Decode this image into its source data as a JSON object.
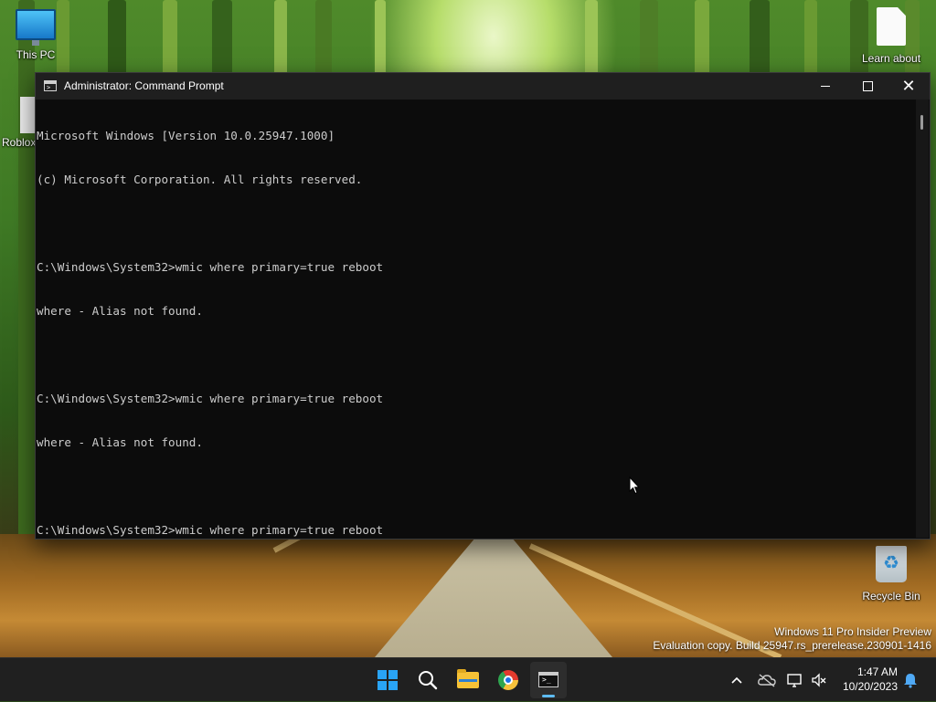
{
  "desktop": {
    "icons": [
      {
        "label": "This PC",
        "icon": "monitor-icon"
      },
      {
        "label": "Learn about",
        "icon": "document-icon"
      },
      {
        "label": "Roblox",
        "icon": "shortcut-icon"
      },
      {
        "label": "Recycle Bin",
        "icon": "recycle-bin-icon"
      }
    ]
  },
  "window": {
    "title": "Administrator: Command Prompt",
    "icon": "cmd-icon",
    "controls": {
      "minimize": "minimize-icon",
      "maximize": "maximize-icon",
      "close": "close-icon"
    }
  },
  "console": {
    "lines": [
      "Microsoft Windows [Version 10.0.25947.1000]",
      "(c) Microsoft Corporation. All rights reserved.",
      "",
      "C:\\Windows\\System32>wmic where primary=true reboot",
      "where - Alias not found.",
      "",
      "C:\\Windows\\System32>wmic where primary=true reboot",
      "where - Alias not found.",
      "",
      "C:\\Windows\\System32>wmic where primary=true reboot"
    ]
  },
  "watermark": {
    "line1": "Windows 11 Pro Insider Preview",
    "line2": "Evaluation copy. Build 25947.rs_prerelease.230901-1416"
  },
  "taskbar": {
    "apps": [
      {
        "name": "start",
        "icon": "windows-logo-icon"
      },
      {
        "name": "search",
        "icon": "search-icon"
      },
      {
        "name": "file-explorer",
        "icon": "folder-icon"
      },
      {
        "name": "chrome",
        "icon": "chrome-icon"
      },
      {
        "name": "command-prompt",
        "icon": "cmd-icon",
        "active": true
      }
    ],
    "tray": {
      "chevron": "chevron-up-icon",
      "onedrive": "onedrive-offline-icon",
      "network": "network-icon",
      "volume": "volume-muted-icon",
      "notification": "notification-bell-icon"
    },
    "clock": {
      "time": "1:47 AM",
      "date": "10/20/2023"
    }
  },
  "colors": {
    "console_bg": "#0c0c0c",
    "console_text": "#cccccc",
    "titlebar": "#1f1f1f",
    "taskbar": "#202020",
    "accent": "#5ebcf2"
  }
}
